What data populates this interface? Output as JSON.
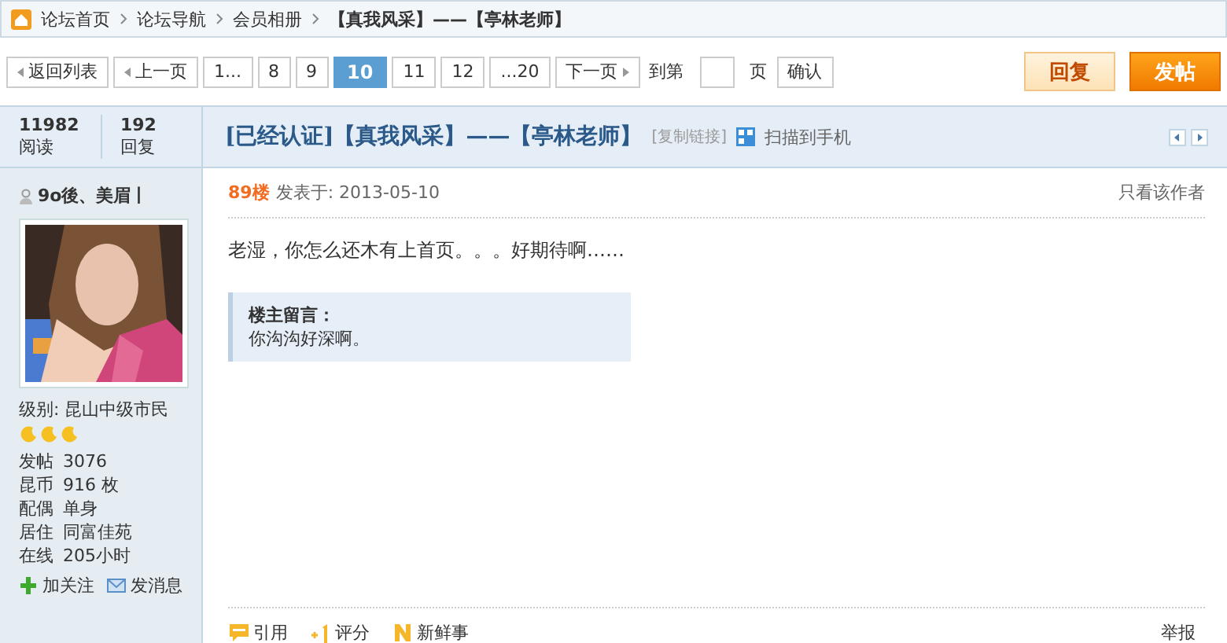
{
  "breadcrumb": [
    "论坛首页",
    "论坛导航",
    "会员相册",
    "【真我风采】——【亭林老师】"
  ],
  "pagination": {
    "back": "返回列表",
    "prev": "上一页",
    "pages": [
      {
        "label": "1...",
        "selected": false
      },
      {
        "label": "8",
        "selected": false
      },
      {
        "label": "9",
        "selected": false
      },
      {
        "label": "10",
        "selected": true
      },
      {
        "label": "11",
        "selected": false
      },
      {
        "label": "12",
        "selected": false
      },
      {
        "label": "...20",
        "selected": false
      }
    ],
    "next": "下一页",
    "goto_label": "到第",
    "page_unit": "页",
    "confirm": "确认"
  },
  "actions": {
    "reply": "回复",
    "post": "发帖"
  },
  "stats": [
    {
      "value": "11982",
      "label": "阅读"
    },
    {
      "value": "192",
      "label": "回复"
    }
  ],
  "thread": {
    "title": "[已经认证]【真我风采】——【亭林老师】",
    "copy_link": "[复制链接]",
    "scan": "扫描到手机"
  },
  "user": {
    "name": "9o後、美眉丨",
    "level": "级别: 昆山中级市民",
    "stars": 3,
    "fields": [
      {
        "label": "发帖",
        "value": "3076"
      },
      {
        "label": "昆币",
        "value": "916 枚"
      },
      {
        "label": "配偶",
        "value": "单身"
      },
      {
        "label": "居住",
        "value": "同富佳苑"
      },
      {
        "label": "在线",
        "value": "205小时"
      }
    ],
    "follow": "加关注",
    "message": "发消息"
  },
  "post": {
    "floor": "89楼",
    "posted": "发表于: 2013-05-10",
    "author_only": "只看该作者",
    "body": "老湿，你怎么还木有上首页。。。好期待啊……",
    "note_title": "楼主留言：",
    "note_body": "你沟沟好深啊。",
    "footer": [
      {
        "kind": "quote",
        "label": "引用"
      },
      {
        "kind": "rate",
        "label": "评分"
      },
      {
        "kind": "news",
        "label": "新鲜事"
      }
    ],
    "report": "举报"
  }
}
